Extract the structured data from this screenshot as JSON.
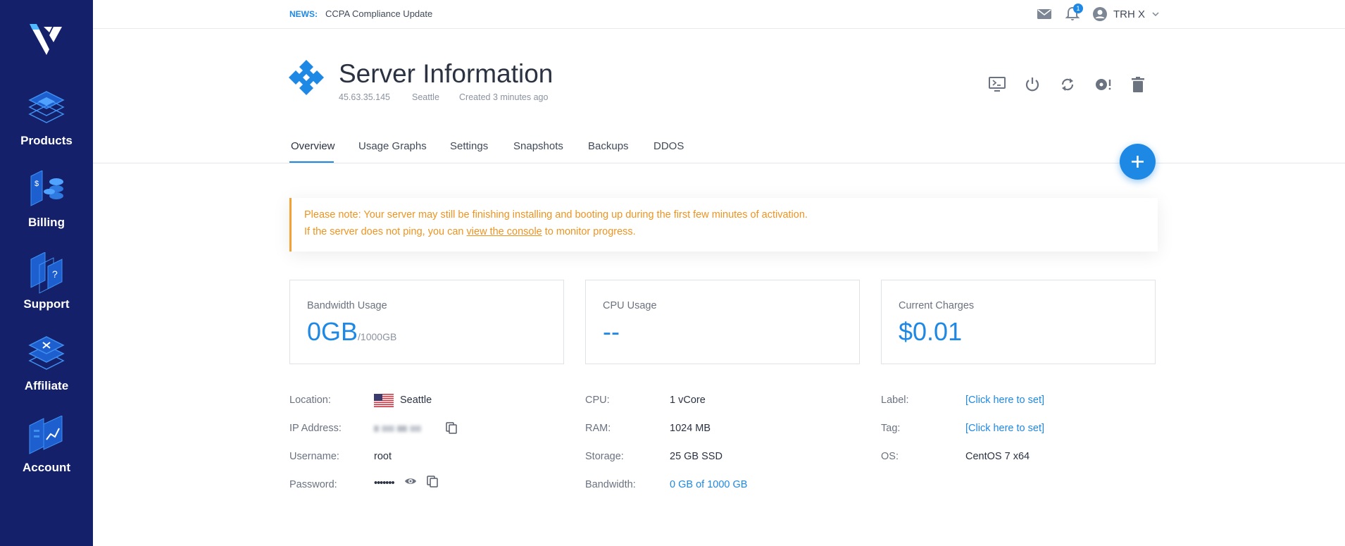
{
  "sidebar": {
    "items": [
      {
        "label": "Products",
        "icon": "products-icon"
      },
      {
        "label": "Billing",
        "icon": "billing-icon"
      },
      {
        "label": "Support",
        "icon": "support-icon"
      },
      {
        "label": "Affiliate",
        "icon": "affiliate-icon"
      },
      {
        "label": "Account",
        "icon": "account-icon"
      }
    ]
  },
  "topbar": {
    "news_label": "NEWS:",
    "news_text": "CCPA Compliance Update",
    "notification_count": "1",
    "user_name": "TRH X"
  },
  "header": {
    "title": "Server Information",
    "ip": "45.63.35.145",
    "location": "Seattle",
    "created": "Created 3 minutes ago"
  },
  "tabs": [
    "Overview",
    "Usage Graphs",
    "Settings",
    "Snapshots",
    "Backups",
    "DDOS"
  ],
  "alert": {
    "line1": "Please note: Your server may still be finishing installing and booting up during the first few minutes of activation.",
    "line2_before": "If the server does not ping, you can ",
    "line2_link": "view the console",
    "line2_after": " to monitor progress."
  },
  "cards": {
    "bandwidth": {
      "title": "Bandwidth Usage",
      "value": "0GB",
      "unit": "/1000GB"
    },
    "cpu": {
      "title": "CPU Usage",
      "value": "--"
    },
    "charges": {
      "title": "Current Charges",
      "value": "$0.01"
    }
  },
  "details": {
    "location": {
      "label": "Location:",
      "value": "Seattle"
    },
    "ip_address": {
      "label": "IP Address:"
    },
    "username": {
      "label": "Username:",
      "value": "root"
    },
    "password": {
      "label": "Password:",
      "value": "•••••••"
    },
    "cpu": {
      "label": "CPU:",
      "value": "1 vCore"
    },
    "ram": {
      "label": "RAM:",
      "value": "1024 MB"
    },
    "storage": {
      "label": "Storage:",
      "value": "25 GB SSD"
    },
    "bandwidth": {
      "label": "Bandwidth:",
      "value": "0 GB of 1000 GB"
    },
    "label": {
      "label": "Label:",
      "value": "[Click here to set]"
    },
    "tag": {
      "label": "Tag:",
      "value": "[Click here to set]"
    },
    "os": {
      "label": "OS:",
      "value": "CentOS 7 x64"
    }
  },
  "colors": {
    "sidebar": "#142069",
    "accent": "#1e88e5",
    "warning": "#f0931e"
  }
}
